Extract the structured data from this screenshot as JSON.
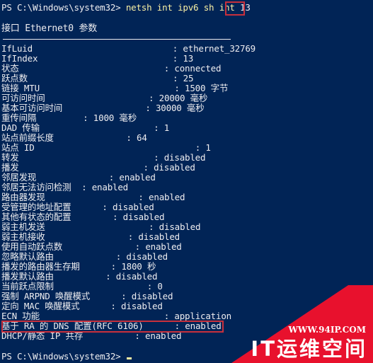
{
  "terminal": {
    "prompt": "PS C:\\Windows\\system32> ",
    "command": "netsh int ipv6 sh int ",
    "command_arg": "13",
    "heading": "接口 Ethernet0 参数",
    "rows": [
      {
        "label": "IfLuid",
        "pad": "                           ",
        "value": ": ethernet_32769"
      },
      {
        "label": "IfIndex",
        "pad": "                          ",
        "value": ": 13"
      },
      {
        "label": "状态",
        "pad": "                            ",
        "value": ": connected"
      },
      {
        "label": "跃点数",
        "pad": "                            ",
        "value": ": 25"
      },
      {
        "label": "链接 MTU",
        "pad": "                          ",
        "value": ": 1500 字节"
      },
      {
        "label": "可访问时间",
        "pad": "                    ",
        "value": ": 20000 毫秒"
      },
      {
        "label": "基本可访问时间",
        "pad": "                ",
        "value": ": 30000 毫秒"
      },
      {
        "label": "重传间隔",
        "pad": "         ",
        "value": ": 1000 毫秒"
      },
      {
        "label": "DAD 传输",
        "pad": "                      ",
        "value": ": 1"
      },
      {
        "label": "站点前缀长度",
        "pad": "              ",
        "value": ": 64"
      },
      {
        "label": "站点 ID",
        "pad": "                               ",
        "value": ": 1"
      },
      {
        "label": "转发",
        "pad": "                          ",
        "value": ": disabled"
      },
      {
        "label": "播发",
        "pad": "                        ",
        "value": ": disabled"
      },
      {
        "label": "邻居发现",
        "pad": "              ",
        "value": ": enabled"
      },
      {
        "label": "邻居无法访问检测",
        "pad": "  ",
        "value": ": enabled"
      },
      {
        "label": "路由器发现",
        "pad": "                  ",
        "value": ": enabled"
      },
      {
        "label": "受管理的地址配置",
        "pad": "      ",
        "value": ": disabled"
      },
      {
        "label": "其他有状态的配置",
        "pad": "        ",
        "value": ": disabled"
      },
      {
        "label": "弱主机发送",
        "pad": "                    ",
        "value": ": disabled"
      },
      {
        "label": "弱主机接收",
        "pad": "                ",
        "value": ": disabled"
      },
      {
        "label": "使用自动跃点数",
        "pad": "              ",
        "value": ": enabled"
      },
      {
        "label": "忽略默认路由",
        "pad": "            ",
        "value": ": disabled"
      },
      {
        "label": "播发的路由器生存期",
        "pad": "      ",
        "value": ": 1800 秒"
      },
      {
        "label": "播发默认路由",
        "pad": "          ",
        "value": ": disabled"
      },
      {
        "label": "当前跃点限制",
        "pad": "                  ",
        "value": ": 0"
      },
      {
        "label": "强制 ARPND 唤醒模式",
        "pad": "      ",
        "value": ": disabled"
      },
      {
        "label": "定向 MAC 唤醒模式",
        "pad": "      ",
        "value": ": disabled"
      },
      {
        "label": "ECN 功能",
        "pad": "                        ",
        "value": ": application"
      },
      {
        "label": "基于 RA 的 DNS 配置(RFC 6106)",
        "pad": "      ",
        "value": ": enabled"
      },
      {
        "label": "DHCP/静态 IP 共存",
        "pad": "          ",
        "value": ": enabled"
      }
    ],
    "final_prompt": "PS C:\\Windows\\system32> "
  },
  "highlights": {
    "box_color": "#c8303c"
  },
  "watermark": {
    "url": "WWW.94IP.COM",
    "name": "IT运维空间",
    "color": "#e8112d"
  }
}
